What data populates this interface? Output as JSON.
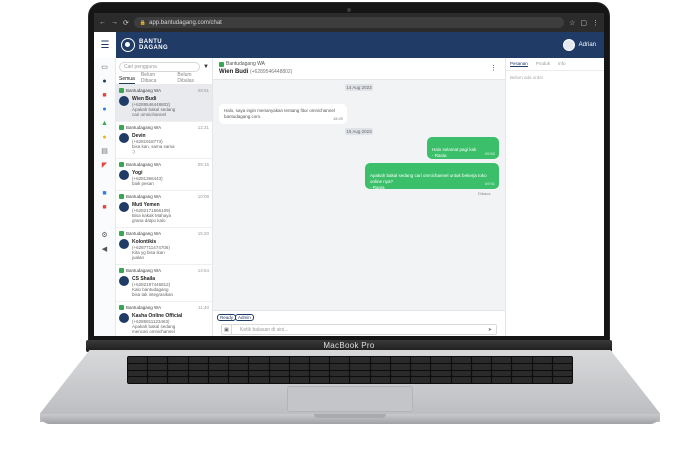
{
  "device": {
    "label": "MacBook Pro"
  },
  "browser": {
    "url": "app.bantudagang.com/chat",
    "back": "←",
    "forward": "→",
    "reload": "⟳"
  },
  "app": {
    "logo_line1": "BANTU",
    "logo_line2": "DAGANG",
    "user_name": "Adrian",
    "menu_icon": "☰"
  },
  "sidebar": {
    "search_placeholder": "Cari pengguna",
    "filter_icon": "▼",
    "tabs": [
      "Semua",
      "Belum Dibaca",
      "Belum Dibalas"
    ]
  },
  "conversations": [
    {
      "source": "Bantudagang WA",
      "time": "09:51",
      "name": "Wien Budi",
      "line1": "(+6289546448802)",
      "line2": "Apakah bakal sedang",
      "line3": "cari omnichannel"
    },
    {
      "source": "Bantudagang WA",
      "time": "12:31",
      "name": "Devin",
      "line1": "(+6281918773)",
      "line2": "bisa kan, sama sama",
      "line3": ":)"
    },
    {
      "source": "Bantudagang WA",
      "time": "09:15",
      "name": "Yogi",
      "line1": "(+6281366443)",
      "line2": "baik pesan",
      "line3": ""
    },
    {
      "source": "Bantudagang WA",
      "time": "10:08",
      "name": "Muti Yemen",
      "line1": "(+6282171566109)",
      "line2": "Bisa kakak Mahaya",
      "line3": "grana datpo kalo"
    },
    {
      "source": "Bantudagang WA",
      "time": "15:20",
      "name": "Kolontikis",
      "line1": "(+6287711474706)",
      "line2": "Kita yg bisa ikan",
      "line3": "jualan"
    },
    {
      "source": "Bantudagang WA",
      "time": "14:54",
      "name": "CS Shaila",
      "line1": "(+6282197446812)",
      "line2": "Kalo bantudagang",
      "line3": "bisa tak integrasikan"
    },
    {
      "source": "Bantudagang WA",
      "time": "11:40",
      "name": "Kasha Online Official",
      "line1": "(+6285811123463)",
      "line2": "Apakah bakal sedang",
      "line3": "mencari omnichannel"
    }
  ],
  "chat": {
    "source": "Bantudagang WA",
    "name": "Wien Budi",
    "phone": "(+6289546448802)",
    "menu_icon": "⋮",
    "dates": [
      "14 Aug 2023",
      "15 Aug 2023"
    ],
    "messages": [
      {
        "dir": "in",
        "text": "Halo, saya ingin menanyakan tentang fitur omnichannel bantudagang.com.",
        "time": "15:20"
      },
      {
        "dir": "out",
        "text": "Halo selamat pagi kak\n- Rania",
        "time": "09:50"
      },
      {
        "dir": "out",
        "text": "Apakah bakal sedang cari omnichannel untuk bekerja toko online nya?\n- Rania",
        "time": "09:51"
      }
    ],
    "status": "Dibaca",
    "chips": [
      "Ready",
      "Admin"
    ],
    "image_icon": "▣",
    "composer_placeholder": "Ketik balasan di sini...",
    "send_icon": "➤"
  },
  "right_panel": {
    "tabs": [
      "Pesanan",
      "Produk",
      "Info"
    ],
    "empty_text": "Belum ada order"
  }
}
